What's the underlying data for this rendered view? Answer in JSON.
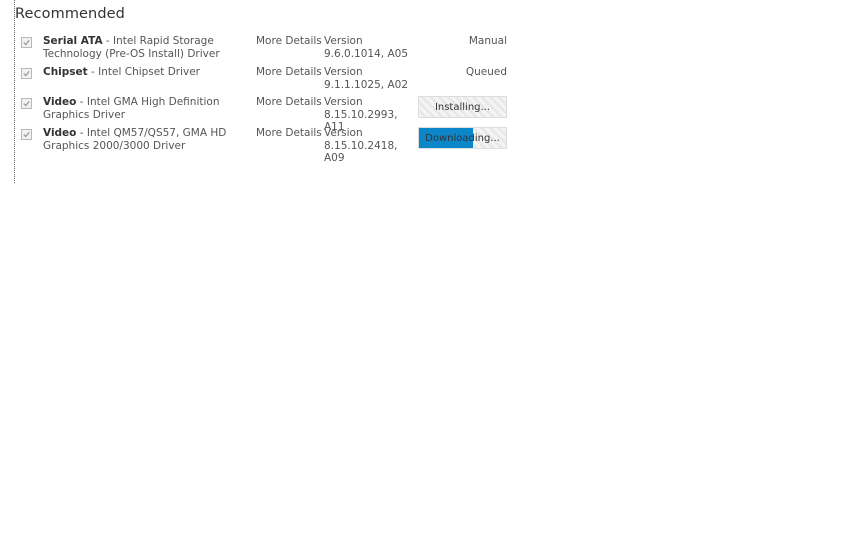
{
  "section": {
    "title": "Recommended"
  },
  "drivers": [
    {
      "category": "Serial ATA",
      "description": " - Intel Rapid Storage Technology (Pre-OS Install) Driver",
      "more_details": "More Details",
      "version": "Version 9.6.0.1014, A05",
      "status": "Manual",
      "checked": true
    },
    {
      "category": "Chipset",
      "description": " - Intel Chipset Driver",
      "more_details": "More Details",
      "version": "Version 9.1.1.1025, A02",
      "status": "Queued",
      "checked": true
    },
    {
      "category": "Video",
      "description": " - Intel GMA High Definition Graphics Driver",
      "more_details": "More Details",
      "version": "Version 8.15.10.2993, A11",
      "status": "Installing...",
      "progress": 0,
      "checked": true
    },
    {
      "category": "Video",
      "description": " - Intel QM57/QS57, GMA HD Graphics 2000/3000 Driver",
      "more_details": "More Details",
      "version": "Version 8.15.10.2418, A09",
      "status": "Downloading...",
      "progress": 0.62,
      "checked": true
    }
  ],
  "colors": {
    "progress_fill": "#0a86c9",
    "check": "#999999"
  },
  "icons": {
    "checkbox": "checkmark-icon"
  }
}
